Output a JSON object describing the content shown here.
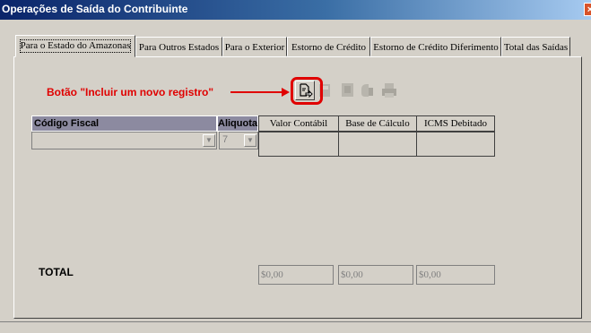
{
  "window": {
    "title": "Operações de Saída do Contribuinte",
    "close_glyph": "×"
  },
  "tabs": [
    {
      "label": "Para o Estado do Amazonas",
      "active": true
    },
    {
      "label": "Para Outros Estados",
      "active": false
    },
    {
      "label": "Para o Exterior",
      "active": false
    },
    {
      "label": "Estorno de Crédito",
      "active": false
    },
    {
      "label": "Estorno de Crédito Diferimento",
      "active": false
    },
    {
      "label": "Total das Saídas",
      "active": false
    }
  ],
  "annotation": {
    "text": "Botão \"Incluir um novo registro\"",
    "color": "#e00000"
  },
  "toolbar": {
    "buttons": [
      {
        "name": "new-record-icon",
        "enabled": true
      },
      {
        "name": "save-icon",
        "enabled": false
      },
      {
        "name": "delete-icon",
        "enabled": false
      },
      {
        "name": "cancel-icon",
        "enabled": false
      },
      {
        "name": "print-icon",
        "enabled": false
      }
    ]
  },
  "grid": {
    "headers": {
      "codigo_fiscal": "Código Fiscal",
      "aliquota": "Aliquota",
      "valor_contabil": "Valor Contábil",
      "base_calculo": "Base de Cálculo",
      "icms_debitado": "ICMS Debitado"
    },
    "row": {
      "codigo_fiscal": "",
      "aliquota": "7"
    }
  },
  "totals": {
    "label": "TOTAL",
    "valor_contabil": "$0,00",
    "base_calculo": "$0,00",
    "icms_debitado": "$0,00"
  }
}
